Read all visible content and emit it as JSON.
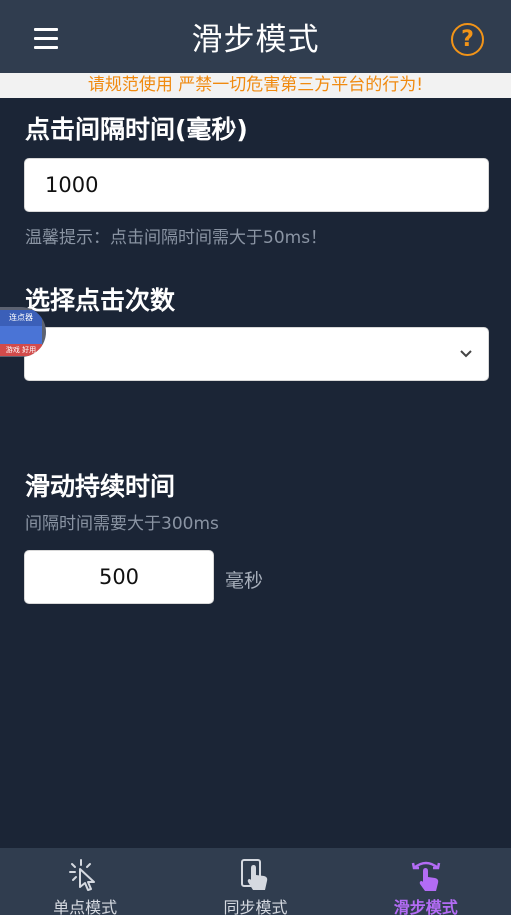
{
  "header": {
    "title": "滑步模式"
  },
  "notice": {
    "text": "请规范使用 严禁一切危害第三方平台的行为!"
  },
  "click_interval": {
    "title": "点击间隔时间(毫秒)",
    "value": "1000",
    "hint": "温馨提示：点击间隔时间需大于50ms！"
  },
  "click_count": {
    "title": "选择点击次数",
    "selected": ""
  },
  "slide_duration": {
    "title": "滑动持续时间",
    "hint": "间隔时间需要大于300ms",
    "value": "500",
    "unit": "毫秒"
  },
  "floating_widget": {
    "top_text": "连点器",
    "bottom_text": "游戏 好用"
  },
  "tabs": [
    {
      "label": "单点模式",
      "icon": "tap-cursor-icon",
      "active": false
    },
    {
      "label": "同步模式",
      "icon": "hand-pointer-icon",
      "active": false
    },
    {
      "label": "滑步模式",
      "icon": "swipe-gesture-icon",
      "active": true
    }
  ],
  "colors": {
    "background": "#1b2536",
    "header": "#303d4f",
    "accent_orange": "#f29418",
    "active_tab": "#b36cf5"
  }
}
